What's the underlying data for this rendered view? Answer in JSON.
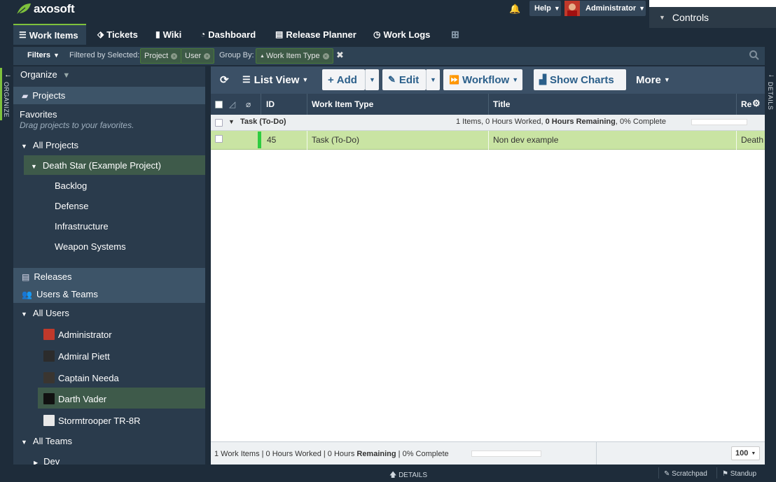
{
  "app": {
    "logo_text": "axosoft",
    "help_label": "Help",
    "user_label": "Administrator",
    "controls_label": "Controls"
  },
  "tabs": [
    {
      "label": "Work Items",
      "icon": "list-icon"
    },
    {
      "label": "Tickets",
      "icon": "tag-icon"
    },
    {
      "label": "Wiki",
      "icon": "document-icon"
    },
    {
      "label": "Dashboard",
      "icon": "gauge-icon"
    },
    {
      "label": "Release Planner",
      "icon": "planner-icon"
    },
    {
      "label": "Work Logs",
      "icon": "clock-icon"
    }
  ],
  "filterbar": {
    "filters_label": "Filters",
    "filtered_by_label": "Filtered by Selected:",
    "chips": [
      "Project",
      "User"
    ],
    "group_by_label": "Group By:",
    "group_chip": "Work Item Type",
    "clear_symbol": "✖"
  },
  "sidebar": {
    "organize_label": "Organize",
    "strip_label": "ORGANIZE",
    "projects_header": "Projects",
    "favorites_label": "Favorites",
    "favorites_hint": "Drag projects to your favorites.",
    "all_projects_label": "All Projects",
    "selected_project": "Death Star (Example Project)",
    "sub_projects": [
      "Backlog",
      "Defense",
      "Infrastructure",
      "Weapon Systems"
    ],
    "releases_header": "Releases",
    "users_header": "Users & Teams",
    "all_users_label": "All Users",
    "users": [
      {
        "name": "Administrator",
        "avatar_color": "#c0392b"
      },
      {
        "name": "Admiral Piett",
        "avatar_color": "#2c2c2c"
      },
      {
        "name": "Captain Needa",
        "avatar_color": "#3a3530"
      },
      {
        "name": "Darth Vader",
        "avatar_color": "#111111"
      },
      {
        "name": "Stormtrooper TR-8R",
        "avatar_color": "#e8e8e8"
      }
    ],
    "selected_user": "Darth Vader",
    "all_teams_label": "All Teams",
    "teams": [
      "Dev"
    ]
  },
  "toolbar": {
    "list_view_label": "List View",
    "add_label": "Add",
    "edit_label": "Edit",
    "workflow_label": "Workflow",
    "show_charts_label": "Show Charts",
    "more_label": "More"
  },
  "grid": {
    "columns": {
      "id": "ID",
      "type": "Work Item Type",
      "title": "Title",
      "release": "Re"
    },
    "group": {
      "label": "Task (To-Do)",
      "summary_a": "1 Items, 0 Hours Worked, ",
      "summary_bold": "0 Hours Remaining",
      "summary_b": ", 0% Complete",
      "progress": 0
    },
    "rows": [
      {
        "id": "45",
        "type": "Task (To-Do)",
        "title": "Non dev example",
        "release": "Death"
      }
    ],
    "footer": {
      "text_a": "1 Work Items | 0 Hours Worked | 0 Hours ",
      "text_bold": "Remaining",
      "text_b": " | 0% Complete",
      "progress": 0,
      "page_size": "100"
    }
  },
  "right_strip_label": "DETAILS",
  "bottom": {
    "details_label": "DETAILS",
    "scratchpad_label": "Scratchpad",
    "standup_label": "Standup"
  },
  "colors": {
    "accent": "#7ec13c",
    "row_highlight": "#c9e4a3",
    "sidebar_selected": "#3e5a4a",
    "button_text": "#2b5f8a"
  }
}
